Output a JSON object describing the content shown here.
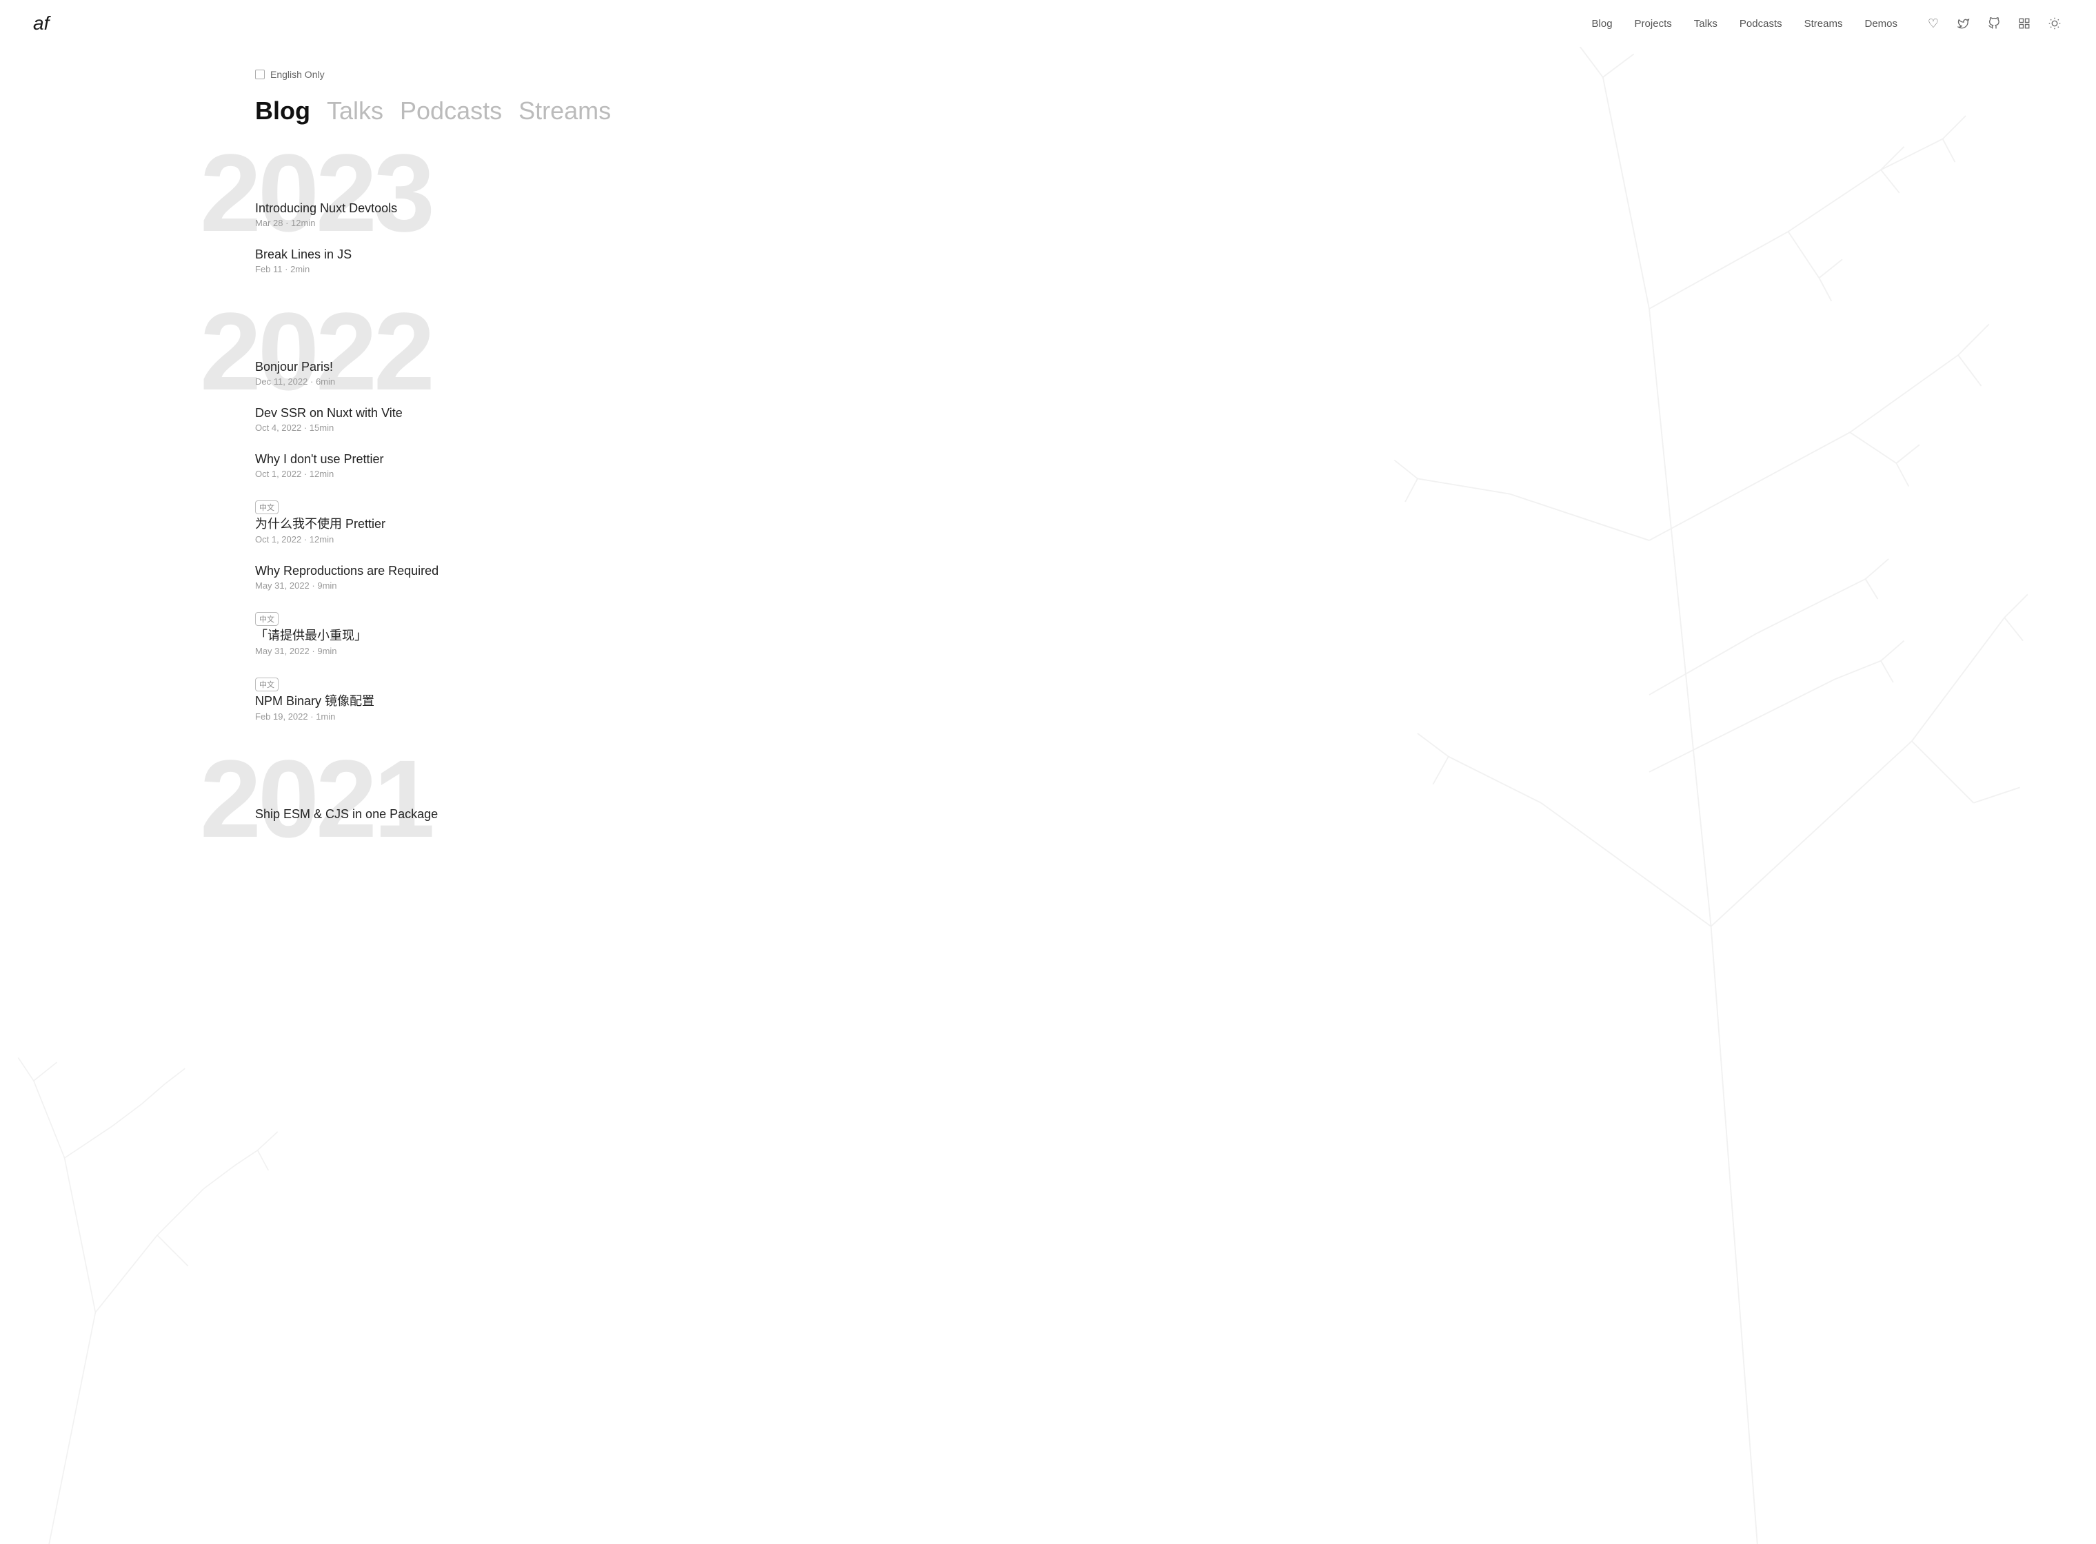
{
  "logo": {
    "text": "af"
  },
  "nav": {
    "links": [
      {
        "label": "Blog",
        "id": "blog"
      },
      {
        "label": "Projects",
        "id": "projects"
      },
      {
        "label": "Talks",
        "id": "talks"
      },
      {
        "label": "Podcasts",
        "id": "podcasts"
      },
      {
        "label": "Streams",
        "id": "streams"
      },
      {
        "label": "Demos",
        "id": "demos"
      }
    ],
    "icons": [
      {
        "symbol": "♡",
        "name": "heart-icon"
      },
      {
        "symbol": "𝕏",
        "name": "twitter-icon"
      },
      {
        "symbol": "⌥",
        "name": "github-icon"
      },
      {
        "symbol": "▦",
        "name": "grid-icon"
      },
      {
        "symbol": "☼",
        "name": "theme-icon"
      }
    ]
  },
  "filter": {
    "label": "English Only",
    "checked": false
  },
  "tabs": [
    {
      "label": "Blog",
      "active": true
    },
    {
      "label": "Talks",
      "active": false
    },
    {
      "label": "Podcasts",
      "active": false
    },
    {
      "label": "Streams",
      "active": false
    }
  ],
  "years": [
    {
      "year": "2023",
      "posts": [
        {
          "title": "Introducing Nuxt Devtools",
          "date": "Mar 28",
          "readTime": "12min",
          "cn": false
        },
        {
          "title": "Break Lines in JS",
          "date": "Feb 11",
          "readTime": "2min",
          "cn": false
        }
      ]
    },
    {
      "year": "2022",
      "posts": [
        {
          "title": "Bonjour Paris!",
          "date": "Dec 11, 2022",
          "readTime": "6min",
          "cn": false
        },
        {
          "title": "Dev SSR on Nuxt with Vite",
          "date": "Oct 4, 2022",
          "readTime": "15min",
          "cn": false
        },
        {
          "title": "Why I don't use Prettier",
          "date": "Oct 1, 2022",
          "readTime": "12min",
          "cn": false
        },
        {
          "title": "为什么我不使用 Prettier",
          "date": "Oct 1, 2022",
          "readTime": "12min",
          "cn": true
        },
        {
          "title": "Why Reproductions are Required",
          "date": "May 31, 2022",
          "readTime": "9min",
          "cn": false
        },
        {
          "title": "「请提供最小重现」",
          "date": "May 31, 2022",
          "readTime": "9min",
          "cn": true
        },
        {
          "title": "NPM Binary 镜像配置",
          "date": "Feb 19, 2022",
          "readTime": "1min",
          "cn": true
        }
      ]
    },
    {
      "year": "2021",
      "posts": [
        {
          "title": "Ship ESM & CJS in one Package",
          "date": "",
          "readTime": "",
          "cn": false
        }
      ]
    }
  ],
  "cn_badge_text": "中文"
}
